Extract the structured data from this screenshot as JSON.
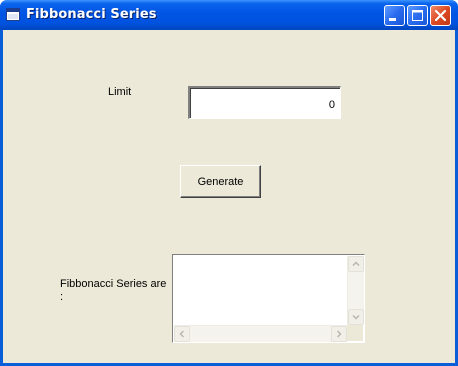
{
  "window": {
    "title": "Fibbonacci Series",
    "icon": "app-window-icon",
    "controls": [
      "minimize-icon",
      "maximize-icon",
      "close-icon"
    ]
  },
  "form": {
    "limit_label": "Limit",
    "limit_value": "0",
    "generate_label": "Generate",
    "series_label": "Fibbonacci Series are :",
    "series_output": ""
  },
  "colors": {
    "titlebar": "#0054e3",
    "client_bg": "#ece9d8",
    "close_button": "#dd4a22"
  }
}
